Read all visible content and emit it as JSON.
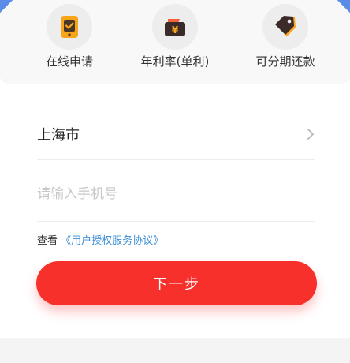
{
  "features": [
    {
      "label": "在线申请",
      "icon": "phone-check-icon",
      "color": "#f8a51c"
    },
    {
      "label": "年利率(单利)",
      "icon": "wallet-yen-icon",
      "color": "#3a2a28"
    },
    {
      "label": "可分期还款",
      "icon": "price-tag-icon",
      "color": "#f5623a"
    }
  ],
  "form": {
    "city": "上海市",
    "phone_placeholder": "请输入手机号",
    "phone_value": ""
  },
  "agreement": {
    "prefix": "查看",
    "link": "《用户授权服务协议》"
  },
  "next_button": "下一步",
  "colors": {
    "primary": "#f8302b",
    "link": "#3e8fd8",
    "corner_accent": "#5b8de8"
  }
}
